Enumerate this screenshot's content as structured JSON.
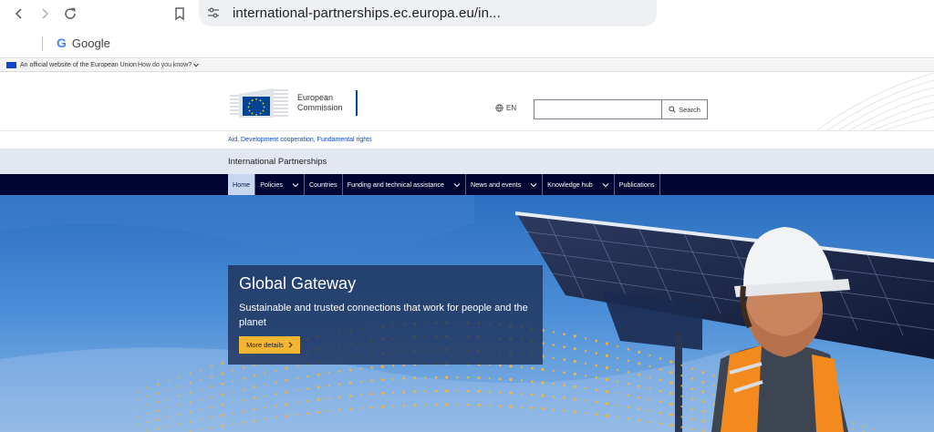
{
  "browser": {
    "url": "international-partnerships.ec.europa.eu/in...",
    "bookmark_google": "Google"
  },
  "eu_banner": {
    "official_text": "An official website of the European Union",
    "how_know": "How do you know?"
  },
  "header": {
    "logo_line1": "European",
    "logo_line2": "Commission",
    "lang": "EN",
    "search_placeholder": "",
    "search_button": "Search"
  },
  "breadcrumb": {
    "text": "Aid, Development cooperation, Fundamental rights"
  },
  "site_name": "International Partnerships",
  "nav": {
    "items": [
      {
        "label": "Home",
        "active": true,
        "dropdown": false
      },
      {
        "label": "Policies",
        "active": false,
        "dropdown": true
      },
      {
        "label": "Countries",
        "active": false,
        "dropdown": false
      },
      {
        "label": "Funding and technical assistance",
        "active": false,
        "dropdown": true
      },
      {
        "label": "News and events",
        "active": false,
        "dropdown": true
      },
      {
        "label": "Knowledge hub",
        "active": false,
        "dropdown": true
      },
      {
        "label": "Publications",
        "active": false,
        "dropdown": false
      }
    ]
  },
  "hero": {
    "title": "Global Gateway",
    "subtitle": "Sustainable and trusted connections that work for people and the planet",
    "button": "More details"
  },
  "colors": {
    "nav_bg": "#000631",
    "accent_yellow": "#f4b533",
    "eu_blue": "#004494",
    "link_blue": "#0e47cb"
  }
}
